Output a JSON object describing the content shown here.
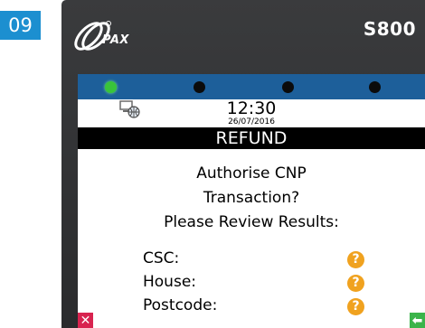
{
  "step_badge": "09",
  "device": {
    "brand": "PAX",
    "model": "S800"
  },
  "status": {
    "leds": [
      "on",
      "off",
      "off",
      "off"
    ],
    "network_icon": "network-computer-icon",
    "time": "12:30",
    "date": "26/07/2016"
  },
  "screen": {
    "title": "REFUND",
    "prompt_lines": [
      "Authorise CNP",
      "Transaction?",
      "Please Review Results:"
    ],
    "checks": [
      {
        "label": "CSC:",
        "result_icon": "question-icon"
      },
      {
        "label": "House:",
        "result_icon": "question-icon"
      },
      {
        "label": "Postcode:",
        "result_icon": "question-icon"
      }
    ]
  },
  "keys": {
    "cancel_icon": "cancel-x-icon",
    "enter_icon": "enter-arrow-icon"
  },
  "colors": {
    "badge": "#1c8fd0",
    "statusbar": "#1d5f9a",
    "led_on": "#39c43a",
    "question": "#f0a21f",
    "cancel": "#d8234f",
    "enter": "#3bb44a"
  }
}
